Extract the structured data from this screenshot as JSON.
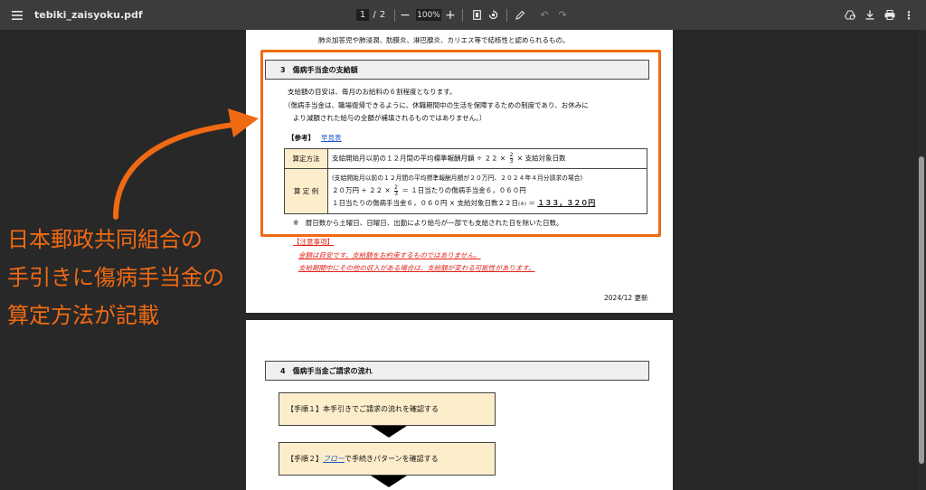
{
  "toolbar": {
    "filename": "tebiki_zaisyoku.pdf",
    "current_page": "1",
    "page_separator": "/",
    "total_pages": "2",
    "zoom": "100%"
  },
  "page1": {
    "top_line": "肺炎加答児や肺浸潤、肋膜炎、淋巴腺炎、カリエス等で結核性と認められるもの。",
    "section3_title": "3　傷病手当金の支給額",
    "para1": "支給額の目安は、毎月のお給料の６割程度となります。",
    "para2": "（傷病手当金は、職場復帰できるように、休職期間中の生活を保障するための制度であり、お休みに",
    "para3": "より減額された給与の全額が補填されるものではありません。）",
    "ref_label": "【参考】",
    "ref_link": "早見表",
    "table": {
      "row1_header": "算定方法",
      "row1_text_a": "支給開始月以前の１２月間の平均標準報酬月額 ÷ ２２ ×",
      "row1_text_b": "× 支給対象日数",
      "row2_header": "算 定 例",
      "row2_line1": "(支給開始月以前の１２月間の平均標準報酬月額が２０万円、２０２４年４月分請求の場合)",
      "row2_line2_a": "２０万円 ÷ ２２ ×",
      "row2_line2_b": "＝ １日当たりの傷病手当金６，０６０円",
      "row2_line3_a": "１日当たりの傷病手当金６，０６０円 × 支給対象日数２２日",
      "row2_line3_mark": "(※)",
      "row2_line3_eq": "＝",
      "row2_result": "１３３，３２０円",
      "frac_num": "2",
      "frac_den": "3"
    },
    "footnote": "※　暦日数から土曜日、日曜日、出勤により給与が一部でも支給された日を除いた日数。",
    "caution_title": "【注意事項】",
    "caution1": "金額は目安です。支給額をお約束するものではありません。",
    "caution2": "支給期間中にその他の収入がある場合は、支給額が変わる可能性があります。",
    "updated": "2024/12 更新"
  },
  "page2": {
    "section4_title": "4　傷病手当金ご請求の流れ",
    "step1": "【手順１】本手引きでご請求の流れを確認する",
    "step2_prefix": "【手順２】",
    "step2_link": "フロー",
    "step2_suffix": "で手続きパターンを確認する"
  },
  "annotation": {
    "line1": "日本郵政共同組合の",
    "line2": "手引きに傷病手当金の",
    "line3": "算定方法が記載"
  },
  "colors": {
    "accent": "#f06a14",
    "link": "#1f56c7",
    "caution": "#e0241c",
    "table_header": "#fdeecb",
    "toolbar": "#3c3c3c"
  }
}
